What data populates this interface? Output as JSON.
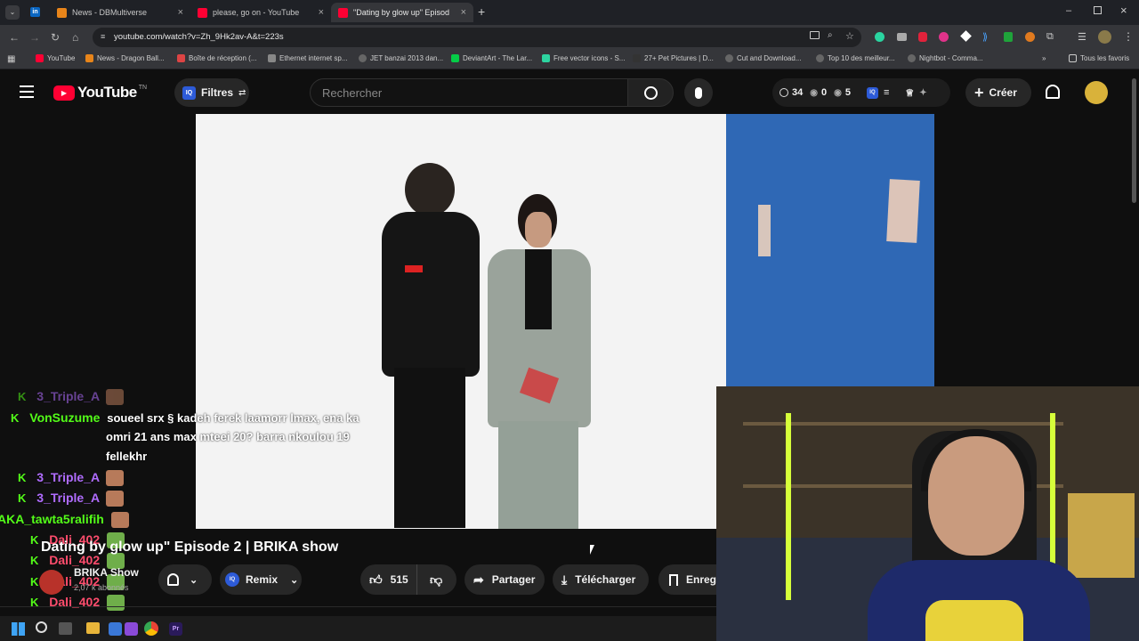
{
  "browser": {
    "tabs": [
      {
        "label": "News - DBMultiverse",
        "active": false,
        "icon": "dragon-ball-icon"
      },
      {
        "label": "please, go on - YouTube",
        "active": false,
        "icon": "youtube-icon"
      },
      {
        "label": "\"Dating by glow up\" Episod",
        "active": true,
        "icon": "youtube-icon"
      }
    ],
    "url": "youtube.com/watch?v=Zh_9Hk2av-A&t=223s",
    "bookmarks": [
      "YouTube",
      "News - Dragon Ball...",
      "Boîte de réception (...",
      "Ethernet internet sp...",
      "JET banzai 2013 dan...",
      "DeviantArt - The Lar...",
      "Free vector icons - S...",
      "27+ Pet Pictures | D...",
      "Cut and Download...",
      "Top 10 des meilleur...",
      "Nightbot - Comma..."
    ],
    "all_bookmarks": "Tous les favoris"
  },
  "youtube": {
    "logo": "YouTube",
    "logo_sup": "TN",
    "filters_label": "Filtres",
    "search_placeholder": "Rechercher",
    "stats": {
      "a": "34",
      "b": "0",
      "c": "5"
    },
    "create_label": "Créer"
  },
  "video": {
    "title": "Dating by glow up\" Episode 2 | BRIKA show",
    "channel": "BRIKA Show",
    "subscribers": "2,07 k abonnés",
    "likes": "515",
    "remix_label": "Remix",
    "share_label": "Partager",
    "download_label": "Télécharger",
    "save_label": "Enreg"
  },
  "chat": [
    {
      "user": "3_Triple_A",
      "color": "#b06cff",
      "text": ""
    },
    {
      "user": "VonSuzume",
      "color": "#53fc18",
      "text": "soueel srx § kadeh ferek laamorr lmax, ena ka"
    },
    {
      "user": "",
      "color": "",
      "text": "omri 21 ans max mteei 20? barra nkoulou 19"
    },
    {
      "user": "",
      "color": "",
      "text": "fellekhr"
    },
    {
      "user": "3_Triple_A",
      "color": "#b06cff",
      "text": ""
    },
    {
      "user": "3_Triple_A",
      "color": "#b06cff",
      "text": ""
    },
    {
      "user": "AKA_tawta5ralifih",
      "color": "#53fc18",
      "text": ""
    },
    {
      "user": "Dali_402",
      "color": "#ff4d6d",
      "text": ""
    },
    {
      "user": "Dali_402",
      "color": "#ff4d6d",
      "text": ""
    },
    {
      "user": "Dali_402",
      "color": "#ff4d6d",
      "text": ""
    },
    {
      "user": "Dali_402",
      "color": "#ff4d6d",
      "text": ""
    },
    {
      "user": "Dali_402",
      "color": "#ff4d6d",
      "text": ""
    }
  ]
}
